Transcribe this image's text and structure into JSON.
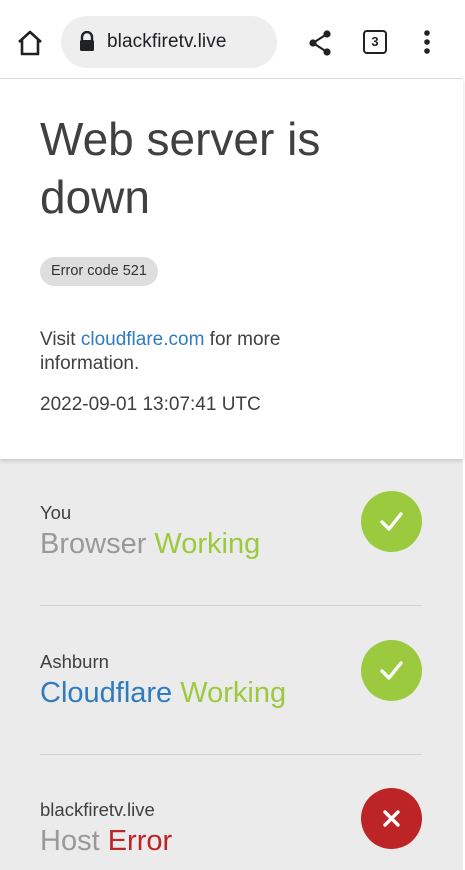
{
  "browser": {
    "url": "blackfiretv.live",
    "tab_count": "3"
  },
  "error": {
    "title": "Web server is down",
    "code_badge": "Error code 521",
    "info_prefix": "Visit ",
    "info_link": "cloudflare.com",
    "info_suffix": " for more information.",
    "timestamp": "2022-09-01 13:07:41 UTC"
  },
  "status": [
    {
      "location": "You",
      "service": "Browser",
      "state": "Working",
      "ok": true
    },
    {
      "location": "Ashburn",
      "service": "Cloudflare",
      "state": "Working",
      "ok": true
    },
    {
      "location": "blackfiretv.live",
      "service": "Host",
      "state": "Error",
      "ok": false
    }
  ],
  "colors": {
    "working": "#9bca3e",
    "error": "#bd2426",
    "link": "#2f7bbf"
  }
}
